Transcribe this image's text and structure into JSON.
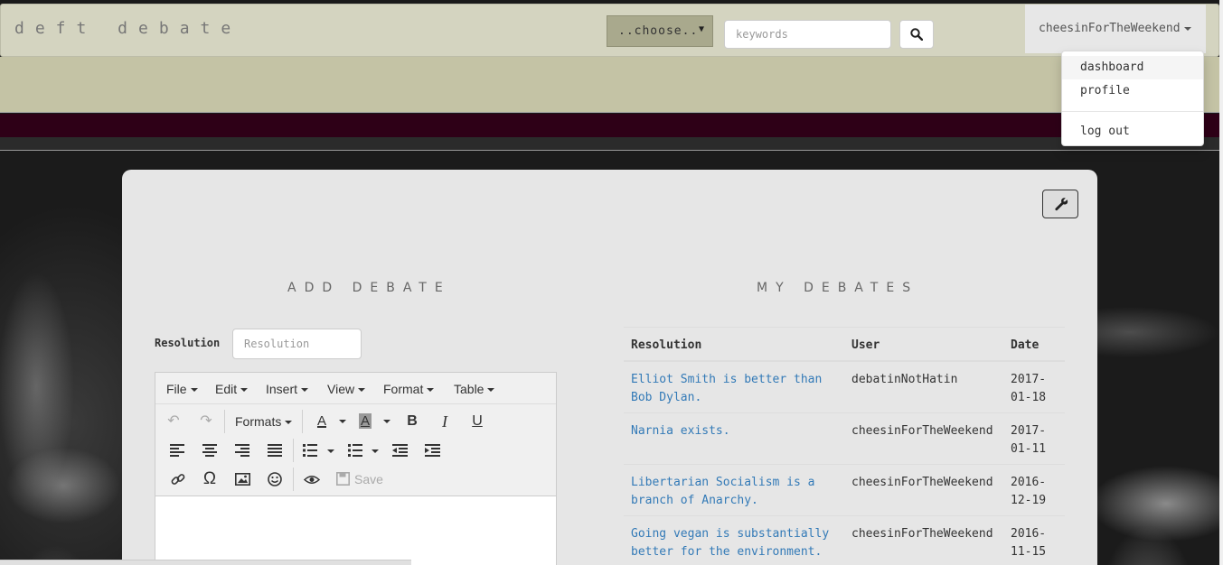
{
  "navbar": {
    "brand": "deft debate",
    "category_select": "..choose..",
    "keywords_placeholder": "keywords",
    "username": "cheesinForTheWeekend"
  },
  "user_dropdown": {
    "items": [
      "dashboard",
      "profile",
      "log out"
    ]
  },
  "add_debate": {
    "title": "ADD DEBATE",
    "resolution_label": "Resolution",
    "resolution_placeholder": "Resolution",
    "editor": {
      "menus": [
        "File",
        "Edit",
        "Insert",
        "View",
        "Format",
        "Table"
      ],
      "formats_label": "Formats",
      "save_label": "Save"
    }
  },
  "my_debates": {
    "title": "MY DEBATES",
    "columns": [
      "Resolution",
      "User",
      "Date"
    ],
    "rows": [
      {
        "resolution": "Elliot Smith is better than Bob Dylan.",
        "user": "debatinNotHatin",
        "date": "2017-01-18"
      },
      {
        "resolution": "Narnia exists.",
        "user": "cheesinForTheWeekend",
        "date": "2017-01-11"
      },
      {
        "resolution": "Libertarian Socialism is a branch of Anarchy.",
        "user": "cheesinForTheWeekend",
        "date": "2016-12-19"
      },
      {
        "resolution": "Going vegan is substantially better for the environment.",
        "user": "cheesinForTheWeekend",
        "date": "2016-11-15"
      }
    ]
  },
  "colors": {
    "navbar": "#d4d4c0",
    "header_band": "#c4c3a5",
    "maroon_bar": "#2e0017",
    "link": "#337ab7",
    "card": "#e6e6e6"
  }
}
